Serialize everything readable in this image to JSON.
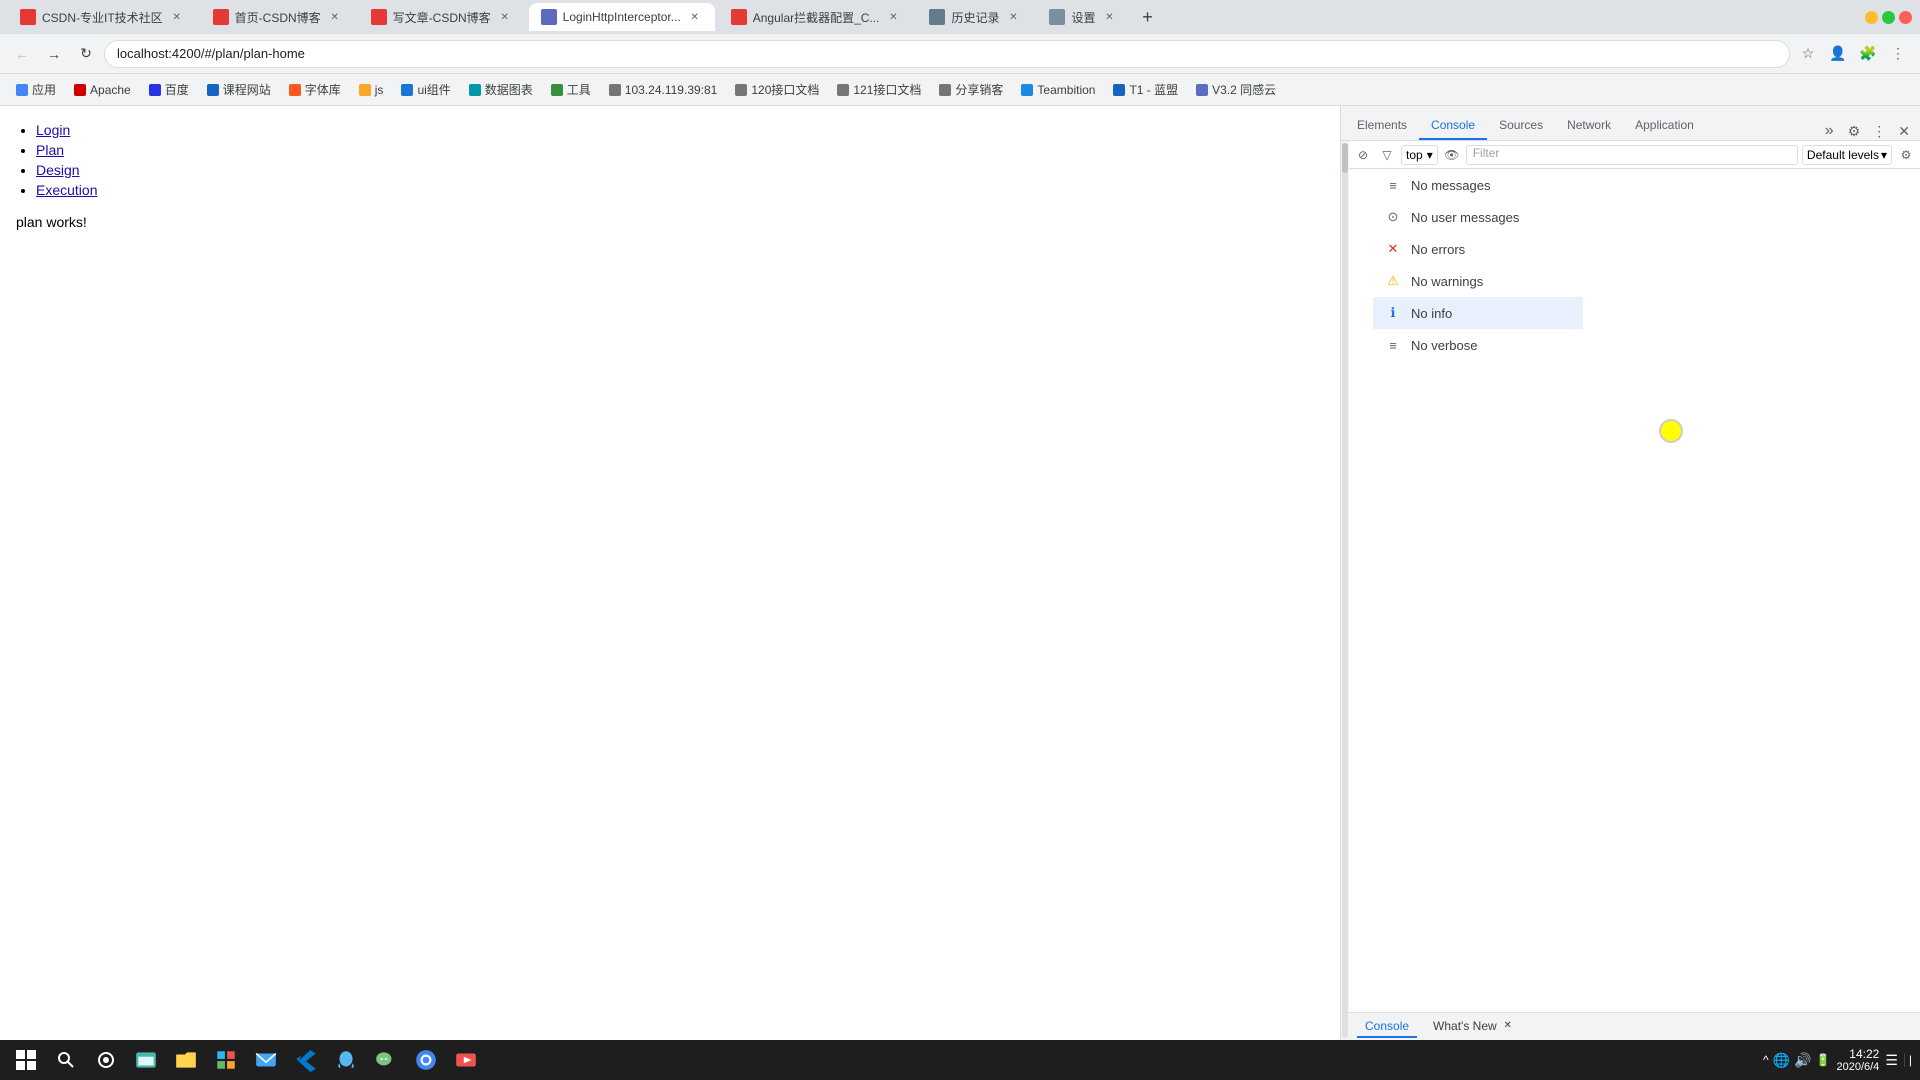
{
  "browser": {
    "tabs": [
      {
        "id": "tab1",
        "favicon_color": "#e53935",
        "title": "CSDN-专业IT技术社区",
        "active": false
      },
      {
        "id": "tab2",
        "favicon_color": "#e53935",
        "title": "首页-CSDN博客",
        "active": false
      },
      {
        "id": "tab3",
        "favicon_color": "#e53935",
        "title": "写文章-CSDN博客",
        "active": false
      },
      {
        "id": "tab4",
        "favicon_color": "#5c6bc0",
        "title": "LoginHttpInterceptor...",
        "active": true
      },
      {
        "id": "tab5",
        "favicon_color": "#e53935",
        "title": "Angular拦截器配置_C...",
        "active": false
      },
      {
        "id": "tab6",
        "favicon_color": "#607d8b",
        "title": "历史记录",
        "active": false
      },
      {
        "id": "tab7",
        "favicon_color": "#78909c",
        "title": "设置",
        "active": false
      }
    ],
    "address": "localhost:4200/#/plan/plan-home",
    "bookmarks": [
      {
        "label": "应用",
        "icon_color": "#4285f4"
      },
      {
        "label": "Apache",
        "icon_color": "#cc0000"
      },
      {
        "label": "百度",
        "icon_color": "#2932e1"
      },
      {
        "label": "课程网站",
        "icon_color": "#1565c0"
      },
      {
        "label": "字体库",
        "icon_color": "#ff5722"
      },
      {
        "label": "js",
        "icon_color": "#f9a825"
      },
      {
        "label": "ui组件",
        "icon_color": "#1976d2"
      },
      {
        "label": "数据图表",
        "icon_color": "#0097a7"
      },
      {
        "label": "工具",
        "icon_color": "#388e3c"
      },
      {
        "label": "103.24.119.39:81",
        "icon_color": "#757575"
      },
      {
        "label": "120接口文档",
        "icon_color": "#757575"
      },
      {
        "label": "121接口文档",
        "icon_color": "#757575"
      },
      {
        "label": "分享销客",
        "icon_color": "#757575"
      },
      {
        "label": "Teambition",
        "icon_color": "#1e88e5"
      },
      {
        "label": "T1 - 蓝盟",
        "icon_color": "#1565c0"
      },
      {
        "label": "V3.2 同感云",
        "icon_color": "#5c6bc0"
      }
    ]
  },
  "page": {
    "nav_items": [
      {
        "label": "Login",
        "href": "#"
      },
      {
        "label": "Plan",
        "href": "#"
      },
      {
        "label": "Design",
        "href": "#"
      },
      {
        "label": "Execution",
        "href": "#"
      }
    ],
    "body_text": "plan works!"
  },
  "devtools": {
    "tabs": [
      {
        "id": "elements",
        "label": "Elements",
        "active": false
      },
      {
        "id": "console",
        "label": "Console",
        "active": true
      },
      {
        "id": "sources",
        "label": "Sources",
        "active": false
      },
      {
        "id": "network",
        "label": "Network",
        "active": false
      },
      {
        "id": "application",
        "label": "Application",
        "active": false
      }
    ],
    "console": {
      "context": "top",
      "filter_placeholder": "Filter",
      "levels_label": "Default levels",
      "dropdown_items": [
        {
          "id": "messages",
          "label": "No messages",
          "icon": "≡",
          "icon_color": "#5f6368",
          "active": false
        },
        {
          "id": "user_messages",
          "label": "No user messages",
          "icon": "⊙",
          "icon_color": "#5f6368",
          "active": false
        },
        {
          "id": "errors",
          "label": "No errors",
          "icon": "✕",
          "icon_color": "#d93025",
          "active": false
        },
        {
          "id": "warnings",
          "label": "No warnings",
          "icon": "⚠",
          "icon_color": "#f9ab00",
          "active": false
        },
        {
          "id": "info",
          "label": "No info",
          "icon": "ℹ",
          "icon_color": "#1a73e8",
          "active": true
        },
        {
          "id": "verbose",
          "label": "No verbose",
          "icon": "≡",
          "icon_color": "#5f6368",
          "active": false
        }
      ]
    },
    "bottom_tabs": [
      {
        "id": "console_bottom",
        "label": "Console",
        "active": true,
        "closable": false
      },
      {
        "id": "whats_new",
        "label": "What's New",
        "active": false,
        "closable": true
      }
    ]
  },
  "taskbar": {
    "time": "14:22",
    "date": "2020/6/4",
    "apps": [
      "⊞",
      "🔍",
      "⊙",
      "☰",
      "🌐",
      "📁",
      "🛒",
      "📧",
      "🌿",
      "💻",
      "🐧",
      "🌐",
      "▶"
    ]
  }
}
